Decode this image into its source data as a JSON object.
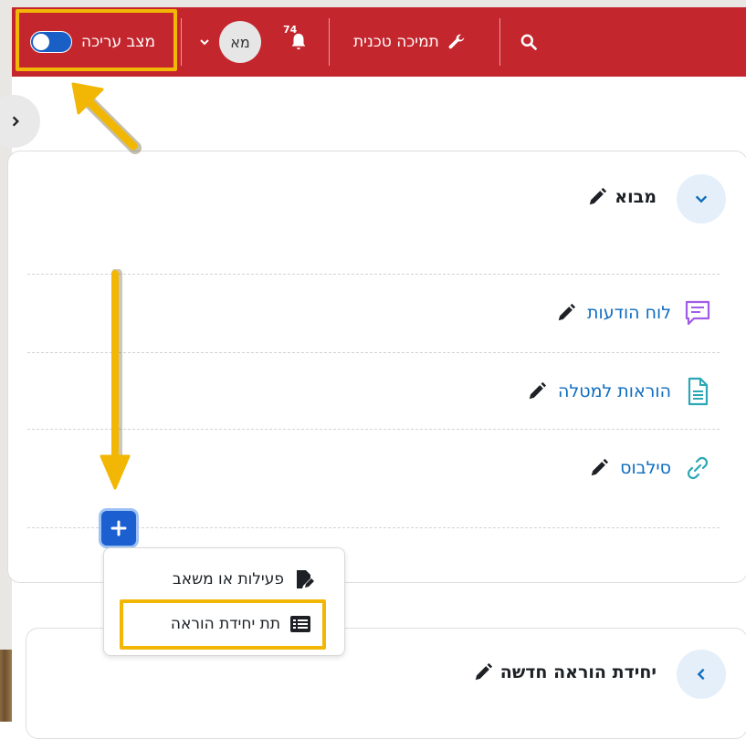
{
  "navbar": {
    "edit_mode_label": "מצב עריכה",
    "avatar_initials": "מא",
    "notifications_count": "74",
    "tech_support_label": "תמיכה טכנית"
  },
  "sections": [
    {
      "title": "מבוא",
      "activities": [
        {
          "label": "לוח הודעות",
          "icon": "forum-icon"
        },
        {
          "label": "הוראות למטלה",
          "icon": "page-icon"
        },
        {
          "label": "סילבוס",
          "icon": "url-link-icon"
        }
      ]
    },
    {
      "title": "יחידת הוראה חדשה"
    }
  ],
  "add_menu": {
    "items": [
      {
        "label": "פעילות או משאב",
        "icon": "file-edit-icon"
      },
      {
        "label": "תת יחידת הוראה",
        "icon": "list-icon"
      }
    ]
  },
  "colors": {
    "navbar": "#c4262d",
    "highlight": "#f2b705",
    "link": "#0f6cbf",
    "toggle": "#1a5fc6"
  }
}
